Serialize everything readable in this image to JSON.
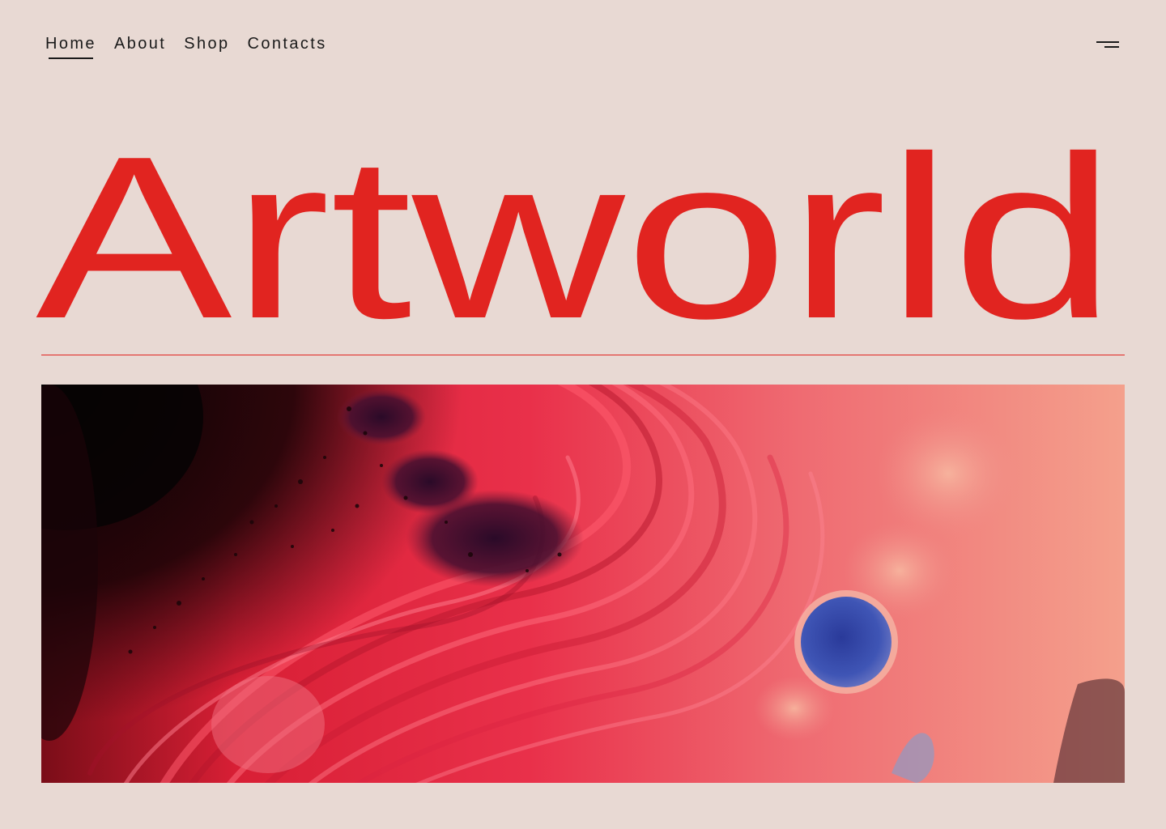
{
  "nav": {
    "items": [
      {
        "label": "Home",
        "active": true
      },
      {
        "label": "About",
        "active": false
      },
      {
        "label": "Shop",
        "active": false
      },
      {
        "label": "Contacts",
        "active": false
      }
    ]
  },
  "menu": {
    "icon": "hamburger-menu-icon"
  },
  "hero": {
    "title": "Artworld",
    "title_color": "#e12420",
    "image": "abstract-fluid-art-image"
  },
  "colors": {
    "background": "#e8d9d3",
    "accent": "#e12420",
    "text": "#1a1a1a"
  }
}
